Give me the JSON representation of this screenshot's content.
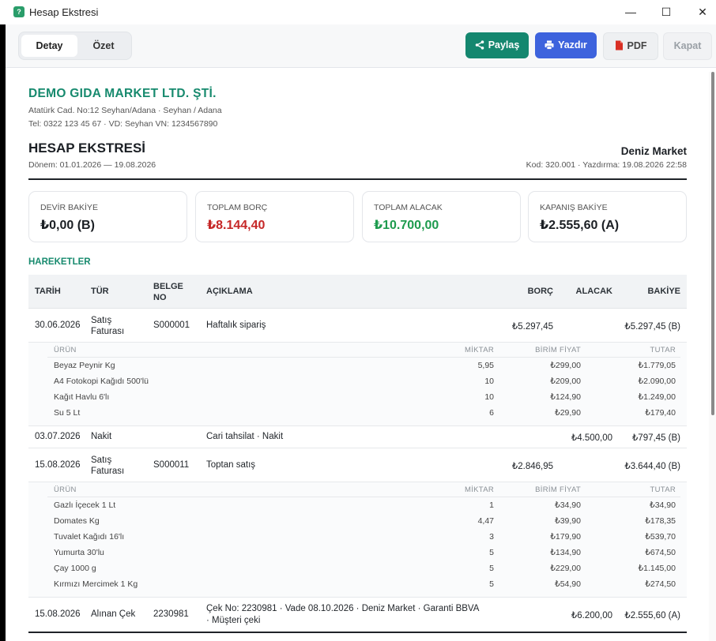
{
  "window": {
    "title": "Hesap Ekstresi",
    "minimize": "—",
    "maximize": "☐",
    "close": "✕"
  },
  "toolbar": {
    "tabs": [
      {
        "label": "Detay",
        "active": true
      },
      {
        "label": "Özet",
        "active": false
      }
    ],
    "share_label": "Paylaş",
    "print_label": "Yazdır",
    "pdf_label": "PDF",
    "close_label": "Kapat"
  },
  "company": {
    "name": "DEMO GIDA MARKET LTD. ŞTİ.",
    "address": "Atatürk Cad. No:12 Seyhan/Adana · Seyhan / Adana",
    "contact": "Tel: 0322 123 45 67 · VD: Seyhan VN: 1234567890"
  },
  "document": {
    "title": "HESAP EKSTRESİ",
    "period": "Dönem: 01.01.2026 — 19.08.2026",
    "customer": "Deniz Market",
    "meta": "Kod: 320.001  ·  Yazdırma: 19.08.2026 22:58"
  },
  "summary": [
    {
      "label": "DEVİR BAKİYE",
      "value": "₺0,00 (B)",
      "color": "#1b1f24"
    },
    {
      "label": "TOPLAM BORÇ",
      "value": "₺8.144,40",
      "color": "#c62828"
    },
    {
      "label": "TOPLAM ALACAK",
      "value": "₺10.700,00",
      "color": "#1e9b4e"
    },
    {
      "label": "KAPANIŞ BAKİYE",
      "value": "₺2.555,60 (A)",
      "color": "#1b1f24"
    }
  ],
  "section_title": "HAREKETLER",
  "table": {
    "headers": {
      "date": "TARİH",
      "type": "TÜR",
      "doc": "BELGE NO",
      "desc": "AÇIKLAMA",
      "debit": "BORÇ",
      "credit": "ALACAK",
      "balance": "BAKİYE"
    },
    "sub_headers": {
      "product": "ÜRÜN",
      "qty": "MİKTAR",
      "unit": "BİRİM FİYAT",
      "total": "TUTAR"
    },
    "rows": [
      {
        "date": "30.06.2026",
        "type": "Satış Faturası",
        "doc": "S000001",
        "desc": "Haftalık sipariş",
        "debit": "₺5.297,45",
        "credit": "",
        "balance": "₺5.297,45 (B)"
      },
      {
        "date": "03.07.2026",
        "type": "Nakit",
        "doc": "",
        "desc": "Cari tahsilat · Nakit",
        "debit": "",
        "credit": "₺4.500,00",
        "balance": "₺797,45 (B)"
      },
      {
        "date": "15.08.2026",
        "type": "Satış Faturası",
        "doc": "S000011",
        "desc": "Toptan satış",
        "debit": "₺2.846,95",
        "credit": "",
        "balance": "₺3.644,40 (B)"
      },
      {
        "date": "15.08.2026",
        "type": "Alınan Çek",
        "doc": "2230981",
        "desc": "Çek No: 2230981 · Vade 08.10.2026 · Deniz Market · Garanti BBVA · Müşteri çeki",
        "debit": "",
        "credit": "₺6.200,00",
        "balance": "₺2.555,60 (A)"
      }
    ],
    "items1": [
      {
        "product": "Beyaz Peynir Kg",
        "qty": "5,95",
        "unit": "₺299,00",
        "total": "₺1.779,05"
      },
      {
        "product": "A4 Fotokopi Kağıdı 500'lü",
        "qty": "10",
        "unit": "₺209,00",
        "total": "₺2.090,00"
      },
      {
        "product": "Kağıt Havlu 6'lı",
        "qty": "10",
        "unit": "₺124,90",
        "total": "₺1.249,00"
      },
      {
        "product": "Su 5 Lt",
        "qty": "6",
        "unit": "₺29,90",
        "total": "₺179,40"
      }
    ],
    "items2": [
      {
        "product": "Gazlı İçecek 1 Lt",
        "qty": "1",
        "unit": "₺34,90",
        "total": "₺34,90"
      },
      {
        "product": "Domates Kg",
        "qty": "4,47",
        "unit": "₺39,90",
        "total": "₺178,35"
      },
      {
        "product": "Tuvalet Kağıdı 16'lı",
        "qty": "3",
        "unit": "₺179,90",
        "total": "₺539,70"
      },
      {
        "product": "Yumurta 30'lu",
        "qty": "5",
        "unit": "₺134,90",
        "total": "₺674,50"
      },
      {
        "product": "Çay 1000 g",
        "qty": "5",
        "unit": "₺229,00",
        "total": "₺1.145,00"
      },
      {
        "product": "Kırmızı Mercimek 1 Kg",
        "qty": "5",
        "unit": "₺54,90",
        "total": "₺274,50"
      }
    ]
  }
}
